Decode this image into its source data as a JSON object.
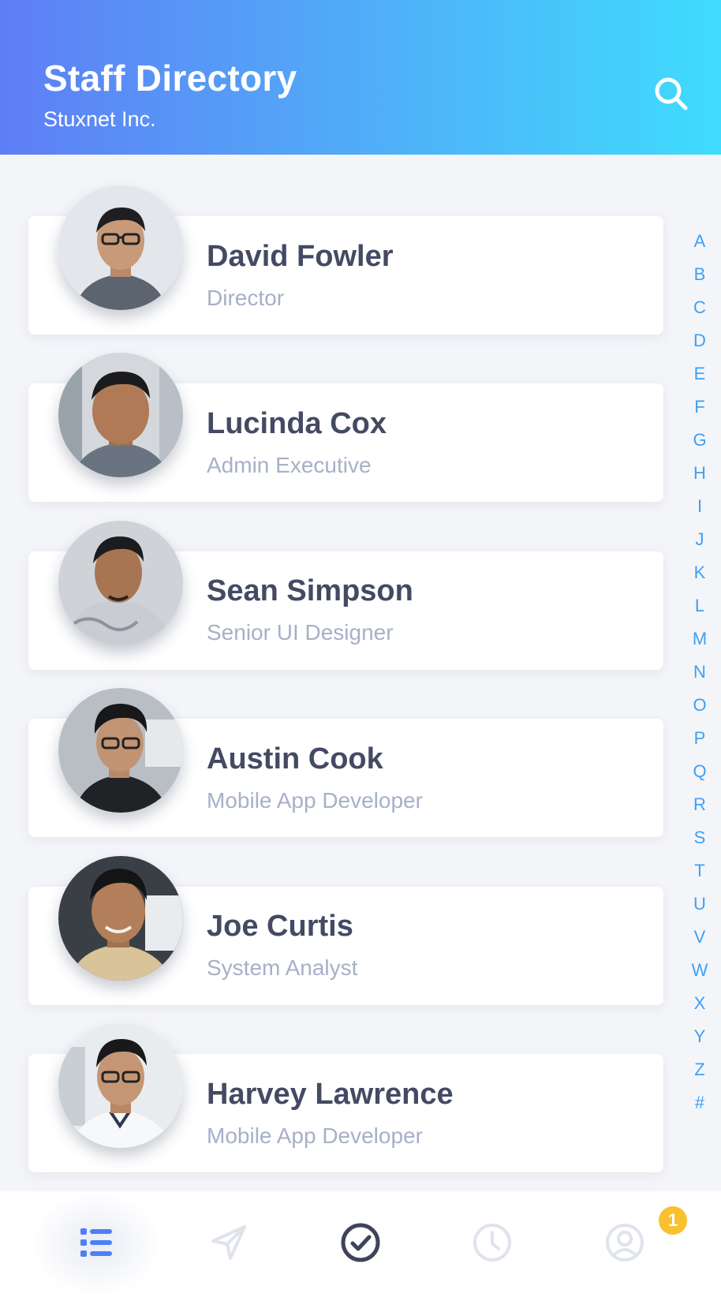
{
  "header": {
    "title": "Staff Directory",
    "subtitle": "Stuxnet Inc.",
    "search_icon": "search-icon"
  },
  "staff": [
    {
      "name": "David Fowler",
      "role": "Director"
    },
    {
      "name": "Lucinda Cox",
      "role": "Admin Executive"
    },
    {
      "name": "Sean Simpson",
      "role": "Senior UI Designer"
    },
    {
      "name": "Austin Cook",
      "role": "Mobile App Developer"
    },
    {
      "name": "Joe Curtis",
      "role": "System Analyst"
    },
    {
      "name": "Harvey Lawrence",
      "role": "Mobile App Developer"
    }
  ],
  "alphabet": [
    "A",
    "B",
    "C",
    "D",
    "E",
    "F",
    "G",
    "H",
    "I",
    "J",
    "K",
    "L",
    "M",
    "N",
    "O",
    "P",
    "Q",
    "R",
    "S",
    "T",
    "U",
    "V",
    "W",
    "X",
    "Y",
    "Z",
    "#"
  ],
  "tabbar": {
    "tabs": [
      {
        "icon": "list-icon",
        "active": true
      },
      {
        "icon": "send-icon",
        "active": false
      },
      {
        "icon": "check-circle-icon",
        "active": false
      },
      {
        "icon": "clock-icon",
        "active": false
      },
      {
        "icon": "profile-icon",
        "active": false
      }
    ],
    "profile_badge": "1"
  },
  "colors": {
    "header_gradient_start": "#5f7ef6",
    "header_gradient_end": "#3fdcfd",
    "accent": "#3da0f5",
    "name_text": "#444a63",
    "role_text": "#a7b0c8",
    "badge": "#fbc02d"
  }
}
